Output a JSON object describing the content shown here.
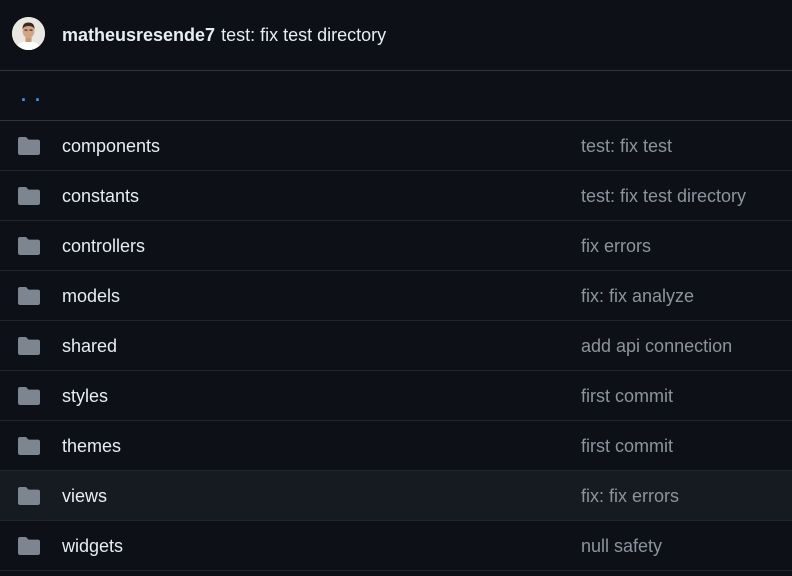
{
  "colors": {
    "background": "#0d1117",
    "row_hover": "#161b22",
    "border": "#30363d",
    "text_primary": "#e6edf3",
    "text_secondary": "#8b949e",
    "link": "#4493f8",
    "folder_icon": "#7d8590"
  },
  "latest_commit": {
    "author": "matheusresende7",
    "message": "test: fix test directory",
    "avatar_icon": "user-avatar"
  },
  "parent_directory": {
    "label": ". ."
  },
  "entries": [
    {
      "icon": "folder-icon",
      "name": "components",
      "commit_message": "test: fix test"
    },
    {
      "icon": "folder-icon",
      "name": "constants",
      "commit_message": "test: fix test directory"
    },
    {
      "icon": "folder-icon",
      "name": "controllers",
      "commit_message": "fix errors"
    },
    {
      "icon": "folder-icon",
      "name": "models",
      "commit_message": "fix: fix analyze"
    },
    {
      "icon": "folder-icon",
      "name": "shared",
      "commit_message": "add api connection"
    },
    {
      "icon": "folder-icon",
      "name": "styles",
      "commit_message": "first commit"
    },
    {
      "icon": "folder-icon",
      "name": "themes",
      "commit_message": "first commit"
    },
    {
      "icon": "folder-icon",
      "name": "views",
      "commit_message": "fix: fix errors",
      "hovered": true
    },
    {
      "icon": "folder-icon",
      "name": "widgets",
      "commit_message": "null safety"
    }
  ]
}
